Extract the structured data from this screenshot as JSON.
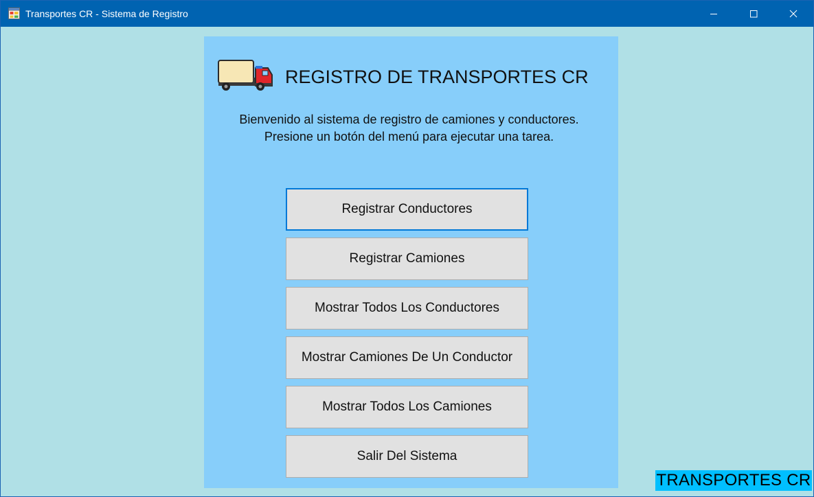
{
  "window": {
    "title": "Transportes CR - Sistema de Registro",
    "app_icon": "form-app-icon",
    "controls": [
      "minimize-icon",
      "maximize-icon",
      "close-icon"
    ]
  },
  "header": {
    "icon": "truck-icon",
    "title": "REGISTRO DE TRANSPORTES CR"
  },
  "welcome": {
    "line1": "Bienvenido al sistema de registro de camiones y conductores.",
    "line2": "Presione un botón del menú para ejecutar una tarea."
  },
  "menu": {
    "register_drivers": "Registrar Conductores",
    "register_trucks": "Registrar Camiones",
    "show_all_drivers": "Mostrar Todos Los Conductores",
    "show_driver_trucks": "Mostrar Camiones De Un Conductor",
    "show_all_trucks": "Mostrar Todos Los Camiones",
    "exit": "Salir Del Sistema"
  },
  "brand_label": "TRANSPORTES CR",
  "colors": {
    "titlebar": "#0063b1",
    "window_background": "#b0e0e6",
    "panel_background": "#87cefa",
    "button_face": "#e1e1e1",
    "focus_border": "#0078d7",
    "brand_label_background": "#00bfff"
  }
}
